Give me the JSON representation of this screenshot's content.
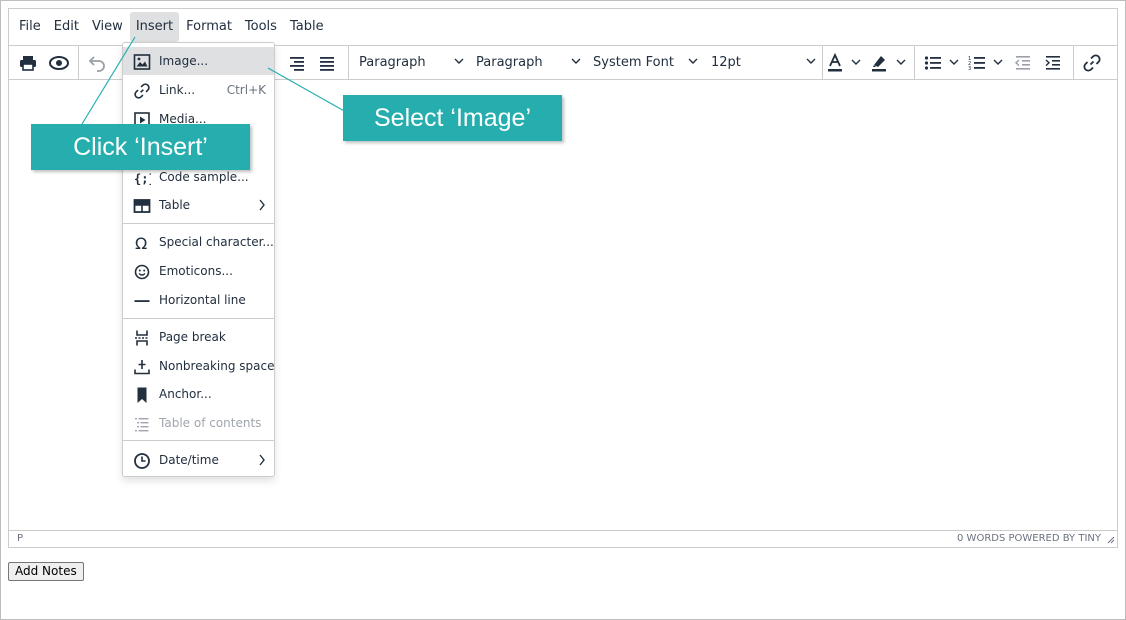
{
  "menubar": {
    "items": [
      {
        "label": "File"
      },
      {
        "label": "Edit"
      },
      {
        "label": "View"
      },
      {
        "label": "Insert",
        "active": true
      },
      {
        "label": "Format"
      },
      {
        "label": "Tools"
      },
      {
        "label": "Table"
      }
    ]
  },
  "toolbar": {
    "block_format": "Paragraph",
    "block_format_2": "Paragraph",
    "font_family": "System Font",
    "font_size": "12pt",
    "icons": [
      "print-icon",
      "preview-icon",
      "undo-icon",
      "align-right-icon",
      "justify-icon",
      "text-color-icon",
      "highlight-color-icon",
      "bullet-list-icon",
      "numbered-list-icon",
      "outdent-icon",
      "indent-icon",
      "link-icon"
    ]
  },
  "insert_menu": {
    "items": [
      {
        "label": "Image...",
        "icon": "image-icon",
        "highlighted": true
      },
      {
        "label": "Link...",
        "icon": "link-icon",
        "shortcut": "Ctrl+K"
      },
      {
        "label": "Media...",
        "icon": "media-icon"
      },
      {
        "label": "Code sample...",
        "icon": "code-sample-icon"
      },
      {
        "label": "Table",
        "icon": "table-icon",
        "submenu": true
      },
      {
        "label": "Special character...",
        "icon": "omega-icon"
      },
      {
        "label": "Emoticons...",
        "icon": "emoticon-icon"
      },
      {
        "label": "Horizontal line",
        "icon": "horizontal-line-icon"
      },
      {
        "label": "Page break",
        "icon": "page-break-icon"
      },
      {
        "label": "Nonbreaking space",
        "icon": "nonbreaking-space-icon"
      },
      {
        "label": "Anchor...",
        "icon": "bookmark-icon"
      },
      {
        "label": "Table of contents",
        "icon": "toc-icon",
        "disabled": true
      },
      {
        "label": "Date/time",
        "icon": "clock-icon",
        "submenu": true
      }
    ]
  },
  "statusbar": {
    "path": "P",
    "info": "0 WORDS  POWERED BY TINY"
  },
  "add_notes_label": "Add Notes",
  "callouts": {
    "insert": "Click ‘Insert’",
    "image": "Select ‘Image’"
  },
  "colors": {
    "callout": "#26aeae",
    "menu_highlight": "#dee0e2",
    "text": "#222f3e",
    "border": "#cccccc"
  }
}
